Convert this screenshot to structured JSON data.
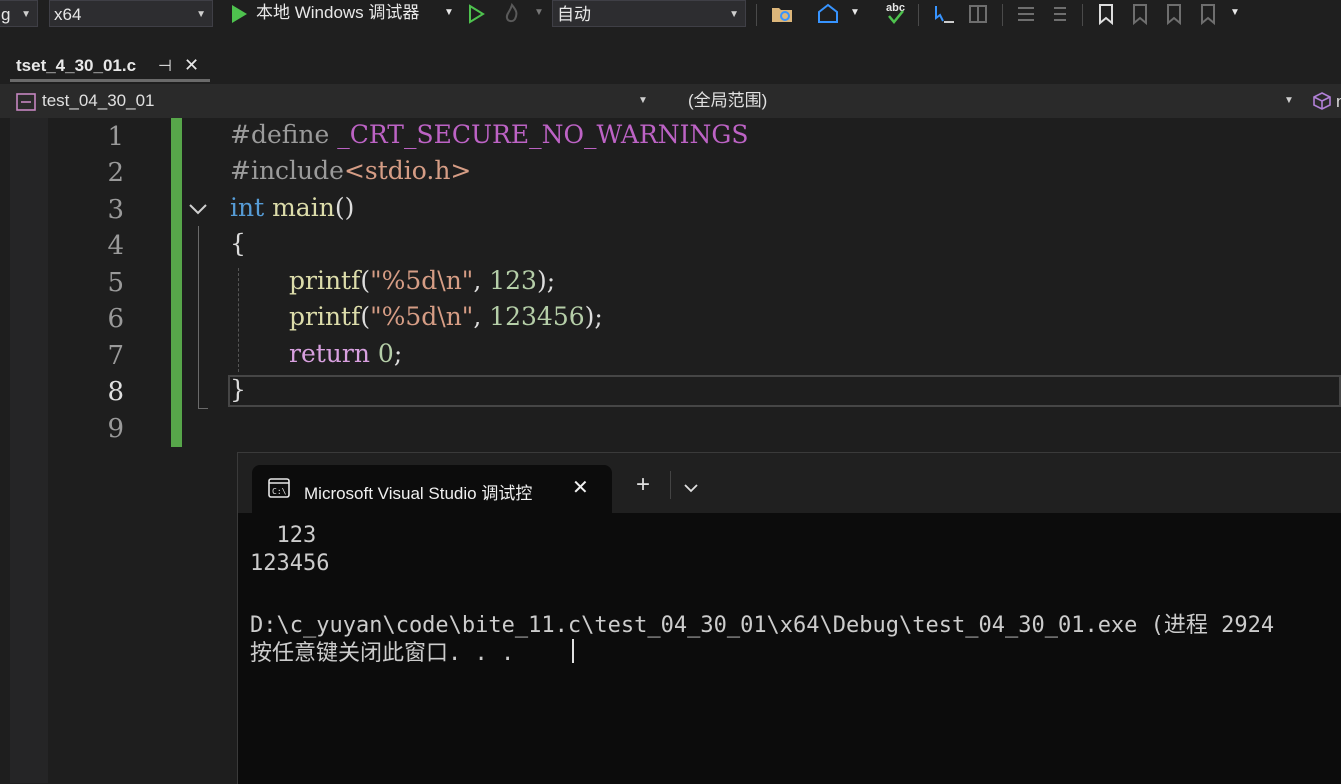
{
  "toolbar": {
    "config_fragment": "g",
    "platform": "x64",
    "debugger_label": "本地 Windows 调试器",
    "auto_label": "自动",
    "spell_icon_text": "abc"
  },
  "tab": {
    "file": "tset_4_30_01.c",
    "pin": "⊣",
    "close": "✕"
  },
  "navbar": {
    "project": "test_04_30_01",
    "scope": "(全局范围)",
    "extra": "n"
  },
  "editor": {
    "line_numbers": [
      "1",
      "2",
      "3",
      "4",
      "5",
      "6",
      "7",
      "8",
      "9"
    ],
    "lines": {
      "l1_directive": "#define ",
      "l1_macro": "_CRT_SECURE_NO_WARNINGS",
      "l2_directive": "#include",
      "l2_header": "<stdio.h>",
      "l3_type": "int",
      "l3_name": " main",
      "l3_parens": "()",
      "l4": "{",
      "l5_fn": "printf",
      "l5_open": "(",
      "l5_str": "\"%5d\\n\"",
      "l5_sep": ", ",
      "l5_num": "123",
      "l5_end": ");",
      "l6_fn": "printf",
      "l6_open": "(",
      "l6_str": "\"%5d\\n\"",
      "l6_sep": ", ",
      "l6_num": "123456",
      "l6_end": ");",
      "l7_kw": "return",
      "l7_sp": " ",
      "l7_num": "0",
      "l7_end": ";",
      "l8": "}"
    }
  },
  "console": {
    "tab_title": "Microsoft Visual Studio 调试控",
    "new_tab": "+",
    "dropdown": "⌄",
    "output": [
      "  123",
      "123456",
      "",
      "D:\\c_yuyan\\code\\bite_11.c\\test_04_30_01\\x64\\Debug\\test_04_30_01.exe (进程 2924",
      "按任意键关闭此窗口. . ."
    ]
  },
  "colors": {
    "accent_green": "#57a64a",
    "keyword": "#569cd6",
    "string": "#d69d85",
    "number": "#b5cea8"
  }
}
